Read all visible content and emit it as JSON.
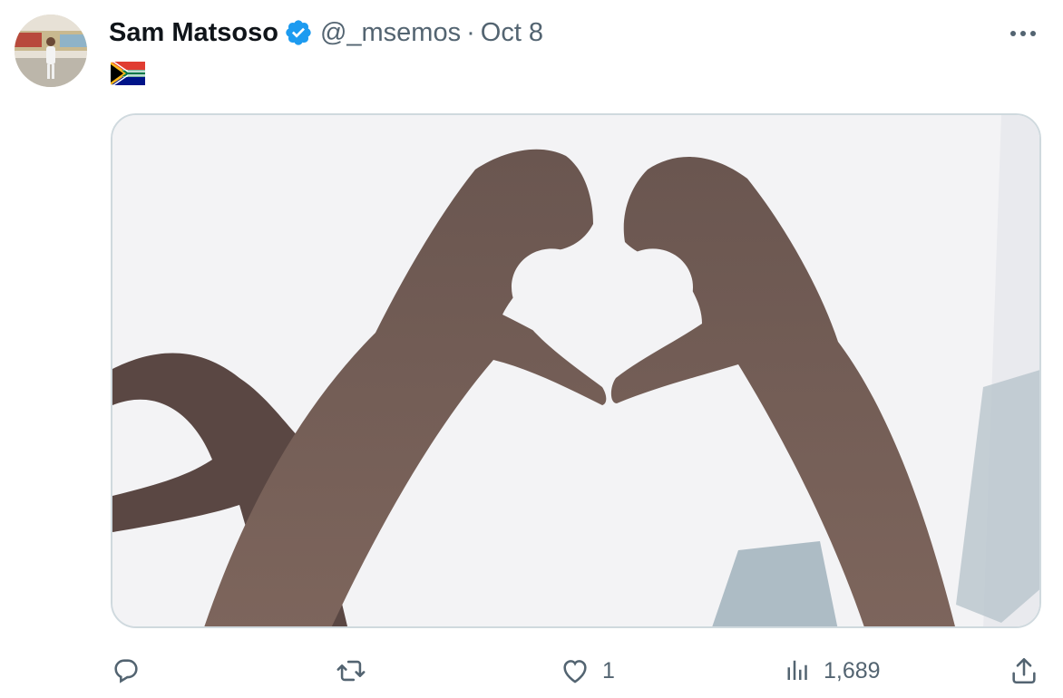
{
  "tweet": {
    "author": {
      "name": "Sam Matsoso",
      "handle": "@_msemos",
      "verified": true,
      "avatar_icon": "avatar-photo",
      "flag_emoji": "🇿🇦"
    },
    "separator": "·",
    "timestamp": "Oct 8",
    "more_icon": "ellipsis-icon",
    "media": {
      "description_icon": "heart-hands-photo"
    },
    "actions": {
      "reply": {
        "icon": "reply-icon",
        "count": ""
      },
      "retweet": {
        "icon": "retweet-icon",
        "count": ""
      },
      "like": {
        "icon": "heart-icon",
        "count": "1"
      },
      "views": {
        "icon": "views-icon",
        "count": "1,689"
      },
      "share": {
        "icon": "share-icon"
      }
    }
  },
  "colors": {
    "text_primary": "#0f1419",
    "text_secondary": "#536471",
    "verified_blue": "#1d9bf0",
    "border": "#cfd9de"
  }
}
